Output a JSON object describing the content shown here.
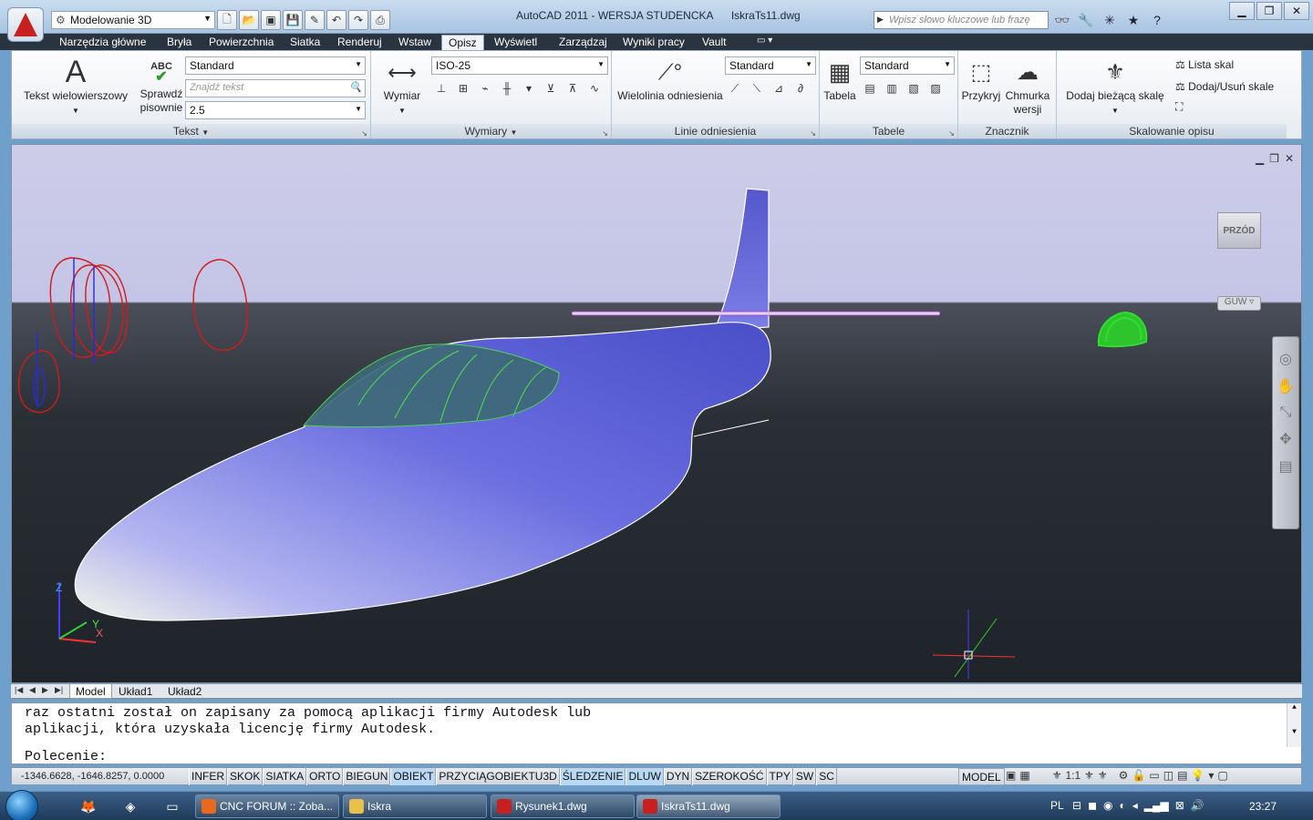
{
  "titlebar": {
    "workspace": "Modelowanie 3D",
    "title": "AutoCAD 2011 - WERSJA STUDENCKA      IskraTs11.dwg",
    "search_placeholder": "Wpisz słowo kluczowe lub frazę",
    "qat_icons": [
      "new-icon",
      "open-icon",
      "save-as-icon",
      "save-icon",
      "edit-icon",
      "undo-icon",
      "redo-icon",
      "plot-icon"
    ]
  },
  "ribbon_tabs": [
    "Narzędzia główne",
    "Bryła",
    "Powierzchnia",
    "Siatka",
    "Renderuj",
    "Wstaw",
    "Opisz",
    "Wyświetl",
    "Zarządzaj",
    "Wyniki pracy",
    "Vault"
  ],
  "active_tab": "Opisz",
  "ribbon": {
    "tekst": {
      "label": "Tekst",
      "mtext_label": "Tekst wielowierszowy",
      "spell_label": "Sprawdź pisownie",
      "style_value": "Standard",
      "find_placeholder": "Znajdź tekst",
      "height_value": "2.5"
    },
    "wymiary": {
      "label": "Wymiary",
      "dim_label": "Wymiar",
      "style_value": "ISO-25"
    },
    "linie": {
      "label": "Linie odniesienia",
      "mleader_label": "Wielolinia odniesienia",
      "style_value": "Standard"
    },
    "tabele": {
      "label": "Tabele",
      "table_label": "Tabela",
      "style_value": "Standard"
    },
    "znacznik": {
      "label": "Znacznik",
      "wipeout_label": "Przykryj",
      "cloud_label": "Chmurka wersji"
    },
    "skalowanie": {
      "label": "Skalowanie opisu",
      "add_scale_label": "Dodaj bieżącą skalę",
      "scale_list_label": "Lista skal",
      "add_remove_label": "Dodaj/Usuń skale"
    }
  },
  "viewport": {
    "viewcube_face": "PRZÓD",
    "wcs_label": "GUW"
  },
  "layout_tabs": [
    "Model",
    "Układ1",
    "Układ2"
  ],
  "active_layout": "Model",
  "command": {
    "history_line1": "raz ostatni został on zapisany za pomocą aplikacji firmy Autodesk lub",
    "history_line2": "aplikacji, która uzyskała licencję firmy Autodesk.",
    "prompt": "Polecenie:"
  },
  "status": {
    "coords": "-1346.6628, -1646.8257, 0.0000",
    "toggles": [
      {
        "label": "INFER",
        "on": false
      },
      {
        "label": "SKOK",
        "on": false
      },
      {
        "label": "SIATKA",
        "on": false
      },
      {
        "label": "ORTO",
        "on": false
      },
      {
        "label": "BIEGUN",
        "on": false
      },
      {
        "label": "OBIEKT",
        "on": true
      },
      {
        "label": "PRZYCIĄGOBIEKTU3D",
        "on": false
      },
      {
        "label": "ŚLEDZENIE",
        "on": true
      },
      {
        "label": "DLUW",
        "on": true
      },
      {
        "label": "DYN",
        "on": false
      },
      {
        "label": "SZEROKOŚĆ",
        "on": false
      },
      {
        "label": "TPY",
        "on": false
      },
      {
        "label": "SW",
        "on": false
      },
      {
        "label": "SC",
        "on": false
      }
    ],
    "model_label": "MODEL",
    "scale": "1:1"
  },
  "taskbar": {
    "items": [
      {
        "label": "CNC FORUM :: Zoba...",
        "color": "#e86a1c"
      },
      {
        "label": "Iskra",
        "color": "#e8c04a"
      },
      {
        "label": "Rysunek1.dwg",
        "color": "#c8201e"
      },
      {
        "label": "IskraTs11.dwg",
        "color": "#c8201e"
      }
    ],
    "lang": "PL",
    "clock": "23:27"
  }
}
